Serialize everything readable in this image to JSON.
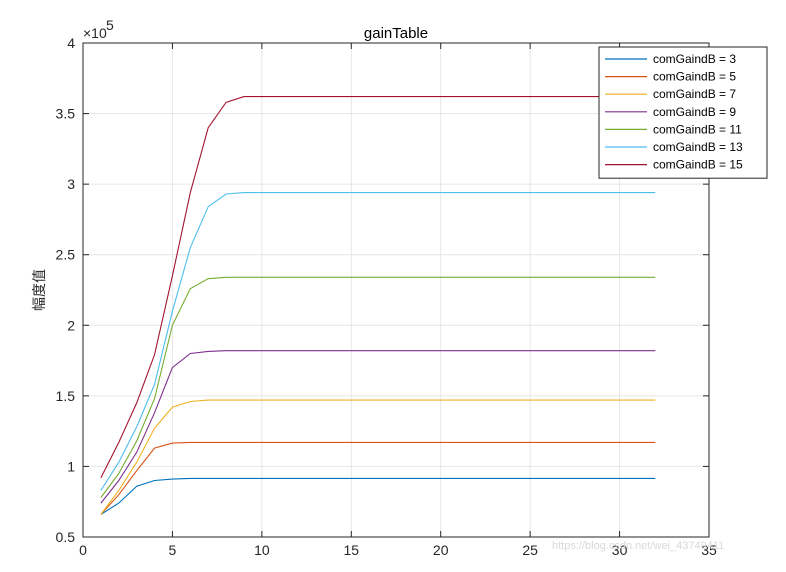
{
  "chart_data": {
    "type": "line",
    "title": "gainTable",
    "xlabel": "",
    "ylabel": "幅度值",
    "exponent_label": "×10",
    "exponent_power": "5",
    "xlim": [
      0,
      35
    ],
    "ylim": [
      0.5,
      4
    ],
    "x_ticks": [
      0,
      5,
      10,
      15,
      20,
      25,
      30,
      35
    ],
    "y_ticks": [
      0.5,
      1,
      1.5,
      2,
      2.5,
      3,
      3.5,
      4
    ],
    "y_tick_labels": [
      "0.5",
      "1",
      "1.5",
      "2",
      "2.5",
      "3",
      "3.5",
      "4"
    ],
    "grid": true,
    "legend_position": "top-right",
    "x": [
      1,
      2,
      3,
      4,
      5,
      6,
      7,
      8,
      9,
      10,
      11,
      12,
      13,
      14,
      15,
      16,
      17,
      18,
      19,
      20,
      21,
      22,
      23,
      24,
      25,
      26,
      27,
      28,
      29,
      30,
      31,
      32
    ],
    "series": [
      {
        "name": "comGaindB = 3",
        "color": "#0072BD",
        "values": [
          0.66,
          0.74,
          0.86,
          0.9,
          0.91,
          0.915,
          0.915,
          0.915,
          0.915,
          0.915,
          0.915,
          0.915,
          0.915,
          0.915,
          0.915,
          0.915,
          0.915,
          0.915,
          0.915,
          0.915,
          0.915,
          0.915,
          0.915,
          0.915,
          0.915,
          0.915,
          0.915,
          0.915,
          0.915,
          0.915,
          0.915,
          0.915
        ]
      },
      {
        "name": "comGaindB = 5",
        "color": "#D95319",
        "values": [
          0.66,
          0.8,
          0.97,
          1.13,
          1.165,
          1.17,
          1.17,
          1.17,
          1.17,
          1.17,
          1.17,
          1.17,
          1.17,
          1.17,
          1.17,
          1.17,
          1.17,
          1.17,
          1.17,
          1.17,
          1.17,
          1.17,
          1.17,
          1.17,
          1.17,
          1.17,
          1.17,
          1.17,
          1.17,
          1.17,
          1.17,
          1.17
        ]
      },
      {
        "name": "comGaindB = 7",
        "color": "#EDB120",
        "values": [
          0.66,
          0.83,
          1.03,
          1.27,
          1.42,
          1.46,
          1.47,
          1.47,
          1.47,
          1.47,
          1.47,
          1.47,
          1.47,
          1.47,
          1.47,
          1.47,
          1.47,
          1.47,
          1.47,
          1.47,
          1.47,
          1.47,
          1.47,
          1.47,
          1.47,
          1.47,
          1.47,
          1.47,
          1.47,
          1.47,
          1.47,
          1.47
        ]
      },
      {
        "name": "comGaindB = 9",
        "color": "#7E2F8E",
        "values": [
          0.74,
          0.9,
          1.1,
          1.38,
          1.7,
          1.8,
          1.815,
          1.82,
          1.82,
          1.82,
          1.82,
          1.82,
          1.82,
          1.82,
          1.82,
          1.82,
          1.82,
          1.82,
          1.82,
          1.82,
          1.82,
          1.82,
          1.82,
          1.82,
          1.82,
          1.82,
          1.82,
          1.82,
          1.82,
          1.82,
          1.82,
          1.82
        ]
      },
      {
        "name": "comGaindB = 11",
        "color": "#77AC30",
        "values": [
          0.78,
          0.95,
          1.18,
          1.48,
          2.0,
          2.26,
          2.33,
          2.34,
          2.34,
          2.34,
          2.34,
          2.34,
          2.34,
          2.34,
          2.34,
          2.34,
          2.34,
          2.34,
          2.34,
          2.34,
          2.34,
          2.34,
          2.34,
          2.34,
          2.34,
          2.34,
          2.34,
          2.34,
          2.34,
          2.34,
          2.34,
          2.34
        ]
      },
      {
        "name": "comGaindB = 13",
        "color": "#4DBEEE",
        "values": [
          0.83,
          1.03,
          1.28,
          1.58,
          2.1,
          2.55,
          2.84,
          2.93,
          2.94,
          2.94,
          2.94,
          2.94,
          2.94,
          2.94,
          2.94,
          2.94,
          2.94,
          2.94,
          2.94,
          2.94,
          2.94,
          2.94,
          2.94,
          2.94,
          2.94,
          2.94,
          2.94,
          2.94,
          2.94,
          2.94,
          2.94,
          2.94
        ]
      },
      {
        "name": "comGaindB = 15",
        "color": "#A2142F",
        "values": [
          0.92,
          1.17,
          1.45,
          1.79,
          2.35,
          2.94,
          3.4,
          3.58,
          3.62,
          3.62,
          3.62,
          3.62,
          3.62,
          3.62,
          3.62,
          3.62,
          3.62,
          3.62,
          3.62,
          3.62,
          3.62,
          3.62,
          3.62,
          3.62,
          3.62,
          3.62,
          3.62,
          3.62,
          3.62,
          3.62,
          3.62,
          3.62
        ]
      }
    ]
  },
  "watermark": "https://blog.csdn.net/wei_43749411"
}
